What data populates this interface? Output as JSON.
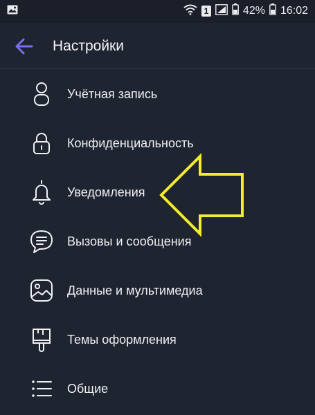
{
  "status_bar": {
    "battery_percent": "42%",
    "time": "16:02",
    "sim_badge": "1"
  },
  "header": {
    "title": "Настройки"
  },
  "menu": {
    "items": [
      {
        "label": "Учётная запись",
        "icon": "person-icon"
      },
      {
        "label": "Конфиденциальность",
        "icon": "lock-icon"
      },
      {
        "label": "Уведомления",
        "icon": "bell-icon"
      },
      {
        "label": "Вызовы и сообщения",
        "icon": "chat-icon"
      },
      {
        "label": "Данные и мультимедиа",
        "icon": "image-icon"
      },
      {
        "label": "Темы оформления",
        "icon": "brush-icon"
      },
      {
        "label": "Общие",
        "icon": "list-icon"
      }
    ]
  },
  "colors": {
    "background": "#1f2431",
    "accent": "#7a6ff0",
    "annotation_arrow": "#f4ee2a"
  }
}
